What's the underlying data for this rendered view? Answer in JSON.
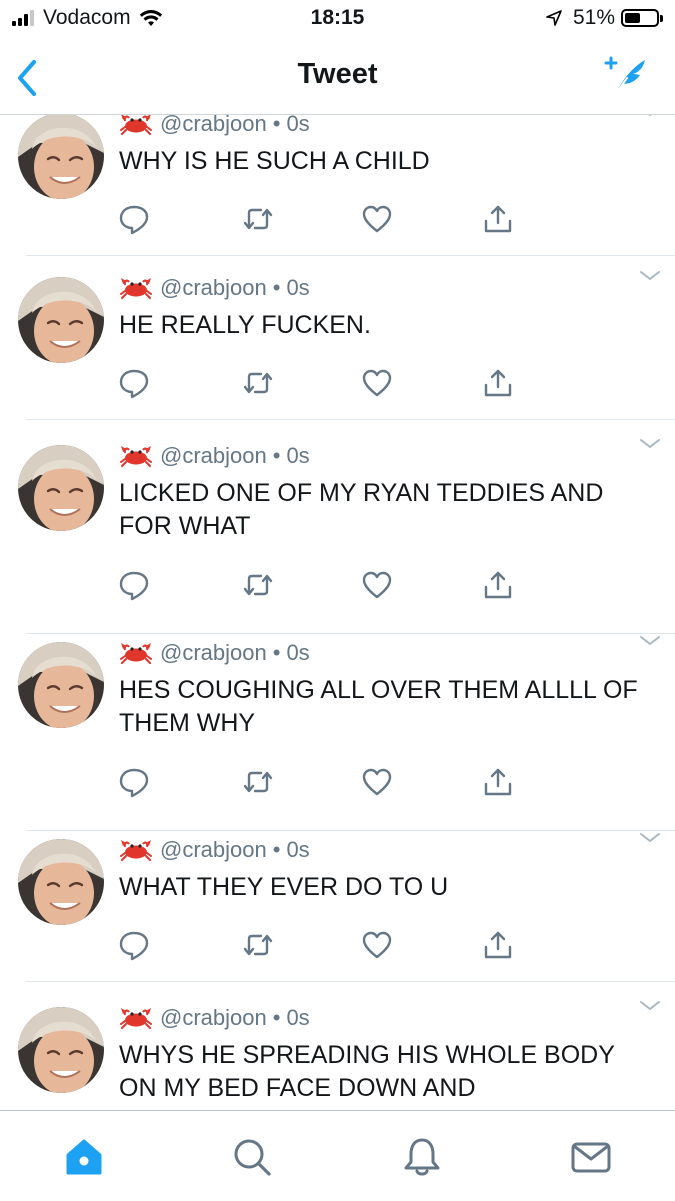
{
  "status_bar": {
    "carrier": "Vodacom",
    "time": "18:15",
    "battery_percent": "51%",
    "battery_level": 0.51,
    "icons": [
      "signal-icon",
      "wifi-icon",
      "location-arrow-icon",
      "battery-icon"
    ]
  },
  "nav": {
    "title": "Tweet",
    "back_icon": "chevron-left-icon",
    "compose_icon": "compose-feather-icon"
  },
  "colors": {
    "accent": "#1da1f2",
    "text": "#14171a",
    "secondary": "#657786",
    "divider": "#e1e8ed"
  },
  "tweets": [
    {
      "handle": "@crabjoon",
      "dot": "•",
      "time": "0s",
      "text": "WHY IS HE SUCH A CHILD"
    },
    {
      "handle": "@crabjoon",
      "dot": "•",
      "time": "0s",
      "text": "HE REALLY FUCKEN."
    },
    {
      "handle": "@crabjoon",
      "dot": "•",
      "time": "0s",
      "text": "LICKED ONE OF MY RYAN TEDDIES AND FOR WHAT"
    },
    {
      "handle": "@crabjoon",
      "dot": "•",
      "time": "0s",
      "text": "HES COUGHING ALL OVER THEM ALLLL OF THEM WHY"
    },
    {
      "handle": "@crabjoon",
      "dot": "•",
      "time": "0s",
      "text": "WHAT THEY EVER DO TO U"
    },
    {
      "handle": "@crabjoon",
      "dot": "•",
      "time": "0s",
      "text": "WHYS HE SPREADING HIS WHOLE BODY ON MY BED FACE DOWN AND"
    }
  ],
  "tweet_action_icons": [
    "reply-icon",
    "retweet-icon",
    "like-heart-icon",
    "share-icon"
  ],
  "tab_bar": {
    "tabs": [
      "home-icon",
      "search-icon",
      "notifications-bell-icon",
      "messages-envelope-icon"
    ],
    "active": "home-icon"
  }
}
